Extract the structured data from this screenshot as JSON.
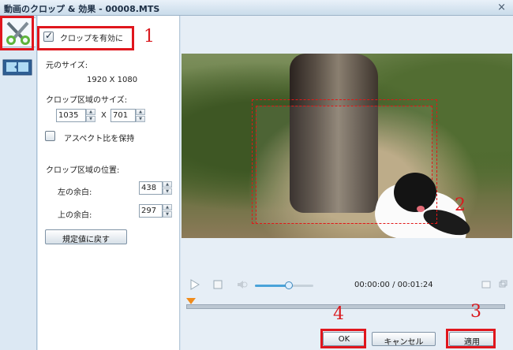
{
  "window": {
    "title": "動画のクロップ & 効果 - 00008.MTS",
    "close_glyph": "×"
  },
  "tabs": {
    "crop_icon": "scissors-icon",
    "effect_icon": "film-icon"
  },
  "crop_panel": {
    "enable_crop_label": "クロップを有効に",
    "enable_crop_checked": true,
    "original_size_label": "元のサイズ:",
    "original_size_value": "1920 X 1080",
    "crop_area_size_label": "クロップ区域のサイズ:",
    "width_value": "1035",
    "size_separator": "X",
    "height_value": "701",
    "keep_aspect_label": "アスペクト比を保持",
    "keep_aspect_checked": false,
    "crop_position_label": "クロップ区域の位置:",
    "left_margin_label": "左の余白:",
    "left_margin_value": "438",
    "top_margin_label": "上の余白:",
    "top_margin_value": "297",
    "reset_button": "規定値に戻す"
  },
  "player": {
    "time_display": "00:00:00 / 00:01:24",
    "volume_level": 0.45
  },
  "buttons": {
    "ok": "OK",
    "cancel": "キャンセル",
    "apply": "適用"
  },
  "annotations": {
    "one": "1",
    "two": "2",
    "three": "3",
    "four": "4"
  },
  "colors": {
    "annotation_red": "#e0161d",
    "volume_accent": "#4aa3d9",
    "timeline_marker": "#f08b1b"
  }
}
